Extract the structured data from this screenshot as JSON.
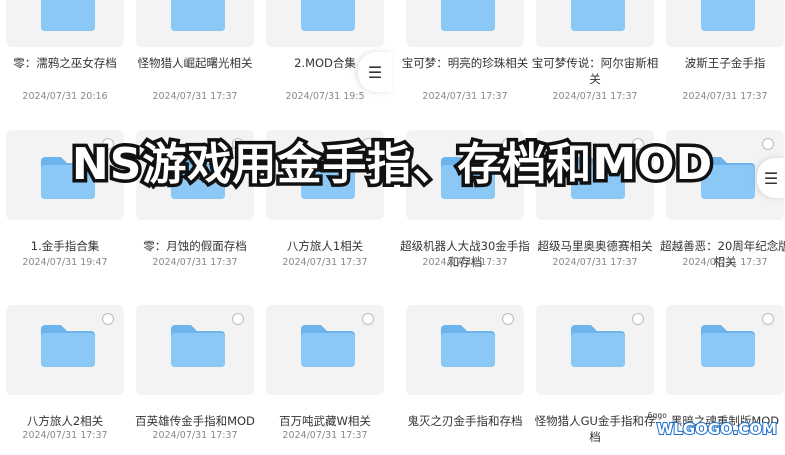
{
  "banner": {
    "title": "NS游戏用金手指、存档和MOD"
  },
  "watermark": {
    "text": "WLGOGO.COM",
    "small": "6ggo"
  },
  "menu": {
    "icon": "menu-icon"
  },
  "rows": [
    [
      {
        "name": "零：濡鸦之巫女存档",
        "date": "2024/07/31 20:16"
      },
      {
        "name": "怪物猎人崛起曙光相关",
        "date": "2024/07/31 17:37"
      },
      {
        "name": "2.MOD合集",
        "date": "2024/07/31 19:5"
      },
      {
        "name": "宝可梦：明亮的珍珠相关",
        "date": "2024/07/31 17:37"
      },
      {
        "name": "宝可梦传说：阿尔宙斯相关",
        "date": "2024/07/31 17:37"
      },
      {
        "name": "波斯王子金手指",
        "date": "2024/07/31 17:37"
      }
    ],
    [
      {
        "name": "1.金手指合集",
        "date": "2024/07/31 19:47"
      },
      {
        "name": "零：月蚀的假面存档",
        "date": "2024/07/31 17:37"
      },
      {
        "name": "八方旅人1相关",
        "date": "2024/07/31 17:37"
      },
      {
        "name": "超级机器人大战30金手指和存档",
        "date": "2024/07/31 17:37"
      },
      {
        "name": "超级马里奥奥德赛相关",
        "date": "2024/07/31 17:37"
      },
      {
        "name": "超越善恶：20周年纪念版相关",
        "date": "2024/07/31 17:37"
      }
    ],
    [
      {
        "name": "八方旅人2相关",
        "date": "2024/07/31 17:37"
      },
      {
        "name": "百英雄传金手指和MOD",
        "date": "2024/07/31 17:37"
      },
      {
        "name": "百万吨武藏W相关",
        "date": "2024/07/31 17:37"
      },
      {
        "name": "鬼灭之刃金手指和存档",
        "date": ""
      },
      {
        "name": "怪物猎人GU金手指和存档",
        "date": ""
      },
      {
        "name": "黑暗之魂重制版MOD",
        "date": ""
      }
    ]
  ]
}
